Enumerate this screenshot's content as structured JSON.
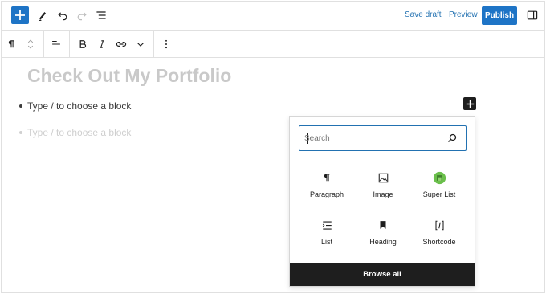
{
  "header": {
    "save_draft": "Save draft",
    "preview": "Preview",
    "publish": "Publish"
  },
  "editor": {
    "title": "Check Out My Portfolio",
    "list_items": [
      "Type / to choose a block"
    ],
    "placeholder": "Type / to choose a block"
  },
  "inserter": {
    "search_placeholder": "Search",
    "blocks": [
      {
        "label": "Paragraph",
        "icon": "paragraph-icon"
      },
      {
        "label": "Image",
        "icon": "image-icon"
      },
      {
        "label": "Super List",
        "icon": "super-list-icon"
      },
      {
        "label": "List",
        "icon": "list-icon"
      },
      {
        "label": "Heading",
        "icon": "heading-icon"
      },
      {
        "label": "Shortcode",
        "icon": "shortcode-icon"
      }
    ],
    "browse_all": "Browse all"
  },
  "colors": {
    "accent": "#1e74c6",
    "dark": "#1e1e1e",
    "title_placeholder": "#c9c9c9",
    "super_list_green": "#6abf4b"
  }
}
